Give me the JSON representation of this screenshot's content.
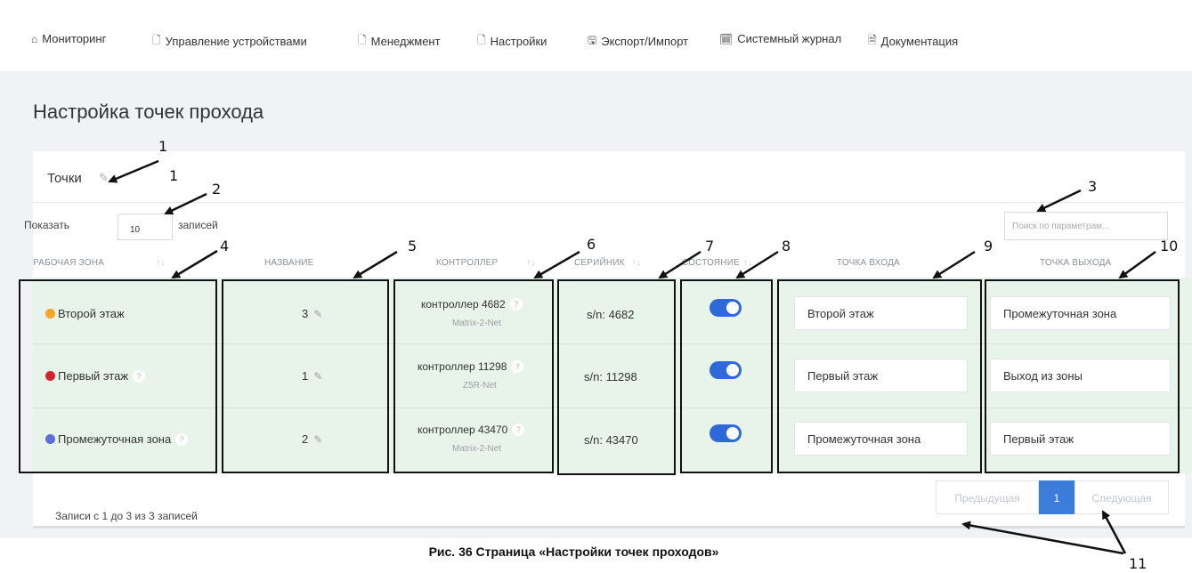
{
  "nav": [
    {
      "icon": "home-icon",
      "glyph": "⌂",
      "label": "Мониторинг"
    },
    {
      "icon": "file-icon",
      "glyph": "🗋",
      "label": "Управление устройствами"
    },
    {
      "icon": "file-icon",
      "glyph": "🗋",
      "label": "Менеджмент"
    },
    {
      "icon": "file-icon",
      "glyph": "🗋",
      "label": "Настройки"
    },
    {
      "icon": "floppy-icon",
      "glyph": "🖫",
      "label": "Экспорт/Импорт"
    },
    {
      "icon": "calendar-icon",
      "glyph": "🗓",
      "label": "Системный журнал"
    },
    {
      "icon": "document-icon",
      "glyph": "🗎",
      "label": "Документация"
    }
  ],
  "page": {
    "title": "Настройка точек прохода",
    "card_title": "Точки",
    "show_label": "Показать",
    "show_value": "10",
    "show_suffix": "записей",
    "search_placeholder": "Поиск по параметрам..."
  },
  "columns": [
    "Рабочая зона",
    "Название",
    "Контроллер",
    "Серийник",
    "Состояние",
    "Точка входа",
    "Точка выхода"
  ],
  "rows": [
    {
      "zone": "Второй этаж",
      "zone_color": "#f5a623",
      "zone_help": false,
      "name": "3",
      "controller": "контроллер 4682",
      "model": "Matrix-2-Net",
      "serial": "s/n: 4682",
      "enabled": true,
      "entry": "Второй этаж",
      "exit": "Промежуточная зона"
    },
    {
      "zone": "Первый этаж",
      "zone_color": "#d0252c",
      "zone_help": true,
      "name": "1",
      "controller": "контроллер 11298",
      "model": "Z5R-Net",
      "serial": "s/n: 11298",
      "enabled": true,
      "entry": "Первый этаж",
      "exit": "Выход из зоны"
    },
    {
      "zone": "Промежуточная зона",
      "zone_color": "#5b6fd6",
      "zone_help": true,
      "name": "2",
      "controller": "контроллер 43470",
      "model": "Matrix-2-Net",
      "serial": "s/n: 43470",
      "enabled": true,
      "entry": "Промежуточная зона",
      "exit": "Первый этаж"
    }
  ],
  "footer": {
    "info": "Записи с 1 до 3 из 3 записей",
    "prev": "Предыдущая",
    "current": "1",
    "next": "Следующая"
  },
  "annotations": [
    "1",
    "1",
    "2",
    "3",
    "4",
    "5",
    "6",
    "7",
    "8",
    "9",
    "10",
    "11"
  ],
  "caption": "Рис. 36 Страница «Настройки точек проходов»"
}
